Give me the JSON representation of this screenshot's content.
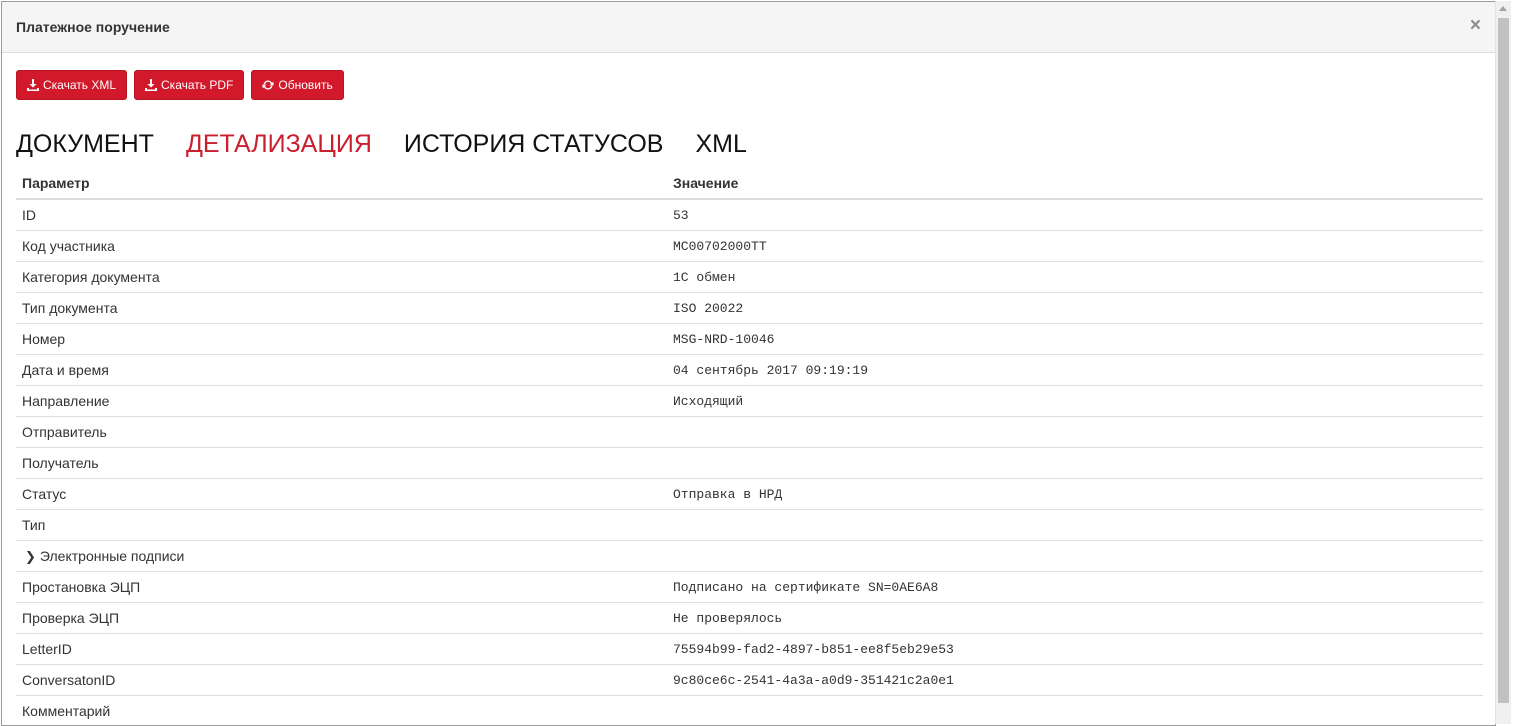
{
  "modal": {
    "title": "Платежное поручение",
    "close_symbol": "×"
  },
  "toolbar": {
    "download_xml": "Скачать XML",
    "download_pdf": "Скачать PDF",
    "refresh": "Обновить"
  },
  "tabs": [
    {
      "label": "ДОКУМЕНТ",
      "active": false
    },
    {
      "label": "ДЕТАЛИЗАЦИЯ",
      "active": true
    },
    {
      "label": "ИСТОРИЯ СТАТУСОВ",
      "active": false
    },
    {
      "label": "XML",
      "active": false
    }
  ],
  "table": {
    "headers": {
      "param": "Параметр",
      "value": "Значение"
    },
    "rows": [
      {
        "param": "ID",
        "value": "53"
      },
      {
        "param": "Код участника",
        "value": "MC00702000TT"
      },
      {
        "param": "Категория документа",
        "value": "1C обмен"
      },
      {
        "param": "Тип документа",
        "value": "ISO 20022"
      },
      {
        "param": "Номер",
        "value": "MSG-NRD-10046"
      },
      {
        "param": "Дата и время",
        "value": "04 сентябрь 2017 09:19:19"
      },
      {
        "param": "Направление",
        "value": "Исходящий"
      },
      {
        "param": "Отправитель",
        "value": ""
      },
      {
        "param": "Получатель",
        "value": ""
      },
      {
        "param": "Статус",
        "value": "Отправка в НРД"
      },
      {
        "param": "Тип",
        "value": ""
      },
      {
        "param": "Электронные подписи",
        "value": "",
        "expandable": true
      },
      {
        "param": "Простановка ЭЦП",
        "value": "Подписано на сертификате SN=0AE6A8"
      },
      {
        "param": "Проверка ЭЦП",
        "value": "Не проверялось"
      },
      {
        "param": "LetterID",
        "value": "75594b99-fad2-4897-b851-ee8f5eb29e53"
      },
      {
        "param": "ConversatonID",
        "value": "9c80ce6c-2541-4a3a-a0d9-351421c2a0e1"
      },
      {
        "param": "Комментарий",
        "value": ""
      }
    ]
  },
  "colors": {
    "accent": "#d2192b",
    "active_tab": "#c8202f"
  }
}
